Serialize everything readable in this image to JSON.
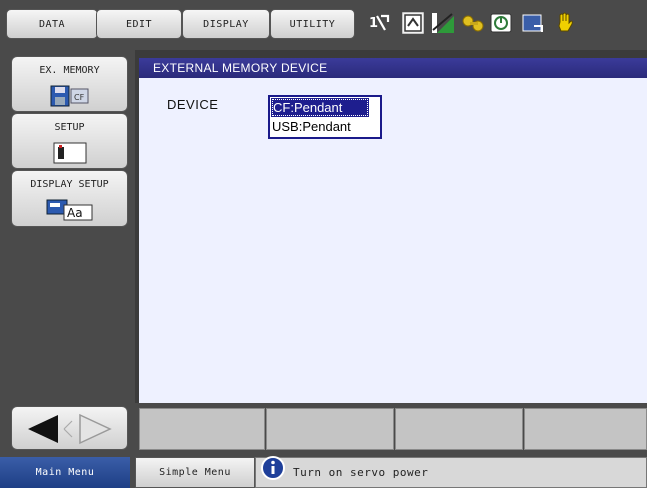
{
  "menubar": {
    "items": [
      {
        "label": "DATA"
      },
      {
        "label": "EDIT"
      },
      {
        "label": "DISPLAY"
      },
      {
        "label": "UTILITY"
      }
    ]
  },
  "status_icons": [
    "axis-toggle-icon",
    "manual-mode-icon",
    "speed-level-icon",
    "key-icon",
    "servo-icon",
    "output-icon",
    "hand-icon"
  ],
  "left_menu": [
    {
      "label": "EX. MEMORY",
      "icon": "disk-cf-icon"
    },
    {
      "label": "SETUP",
      "icon": "setup-icon"
    },
    {
      "label": "DISPLAY SETUP",
      "icon": "display-font-icon"
    }
  ],
  "screen": {
    "title": "EXTERNAL MEMORY DEVICE",
    "device_label": "DEVICE",
    "options": [
      "CF:Pendant",
      "USB:Pendant"
    ],
    "selected": "CF:Pendant"
  },
  "nav": {
    "back_icon": "left-arrow-icon",
    "forward_icon": "right-arrow-icon"
  },
  "statusbar": {
    "main_menu": "Main Menu",
    "simple_menu": "Simple Menu",
    "message": "Turn on servo power"
  },
  "colors": {
    "title_bar": "#2a2a7a",
    "content_bg": "#eef1ff",
    "selection": "#1e1e8e",
    "frame": "#4a4a4a"
  }
}
